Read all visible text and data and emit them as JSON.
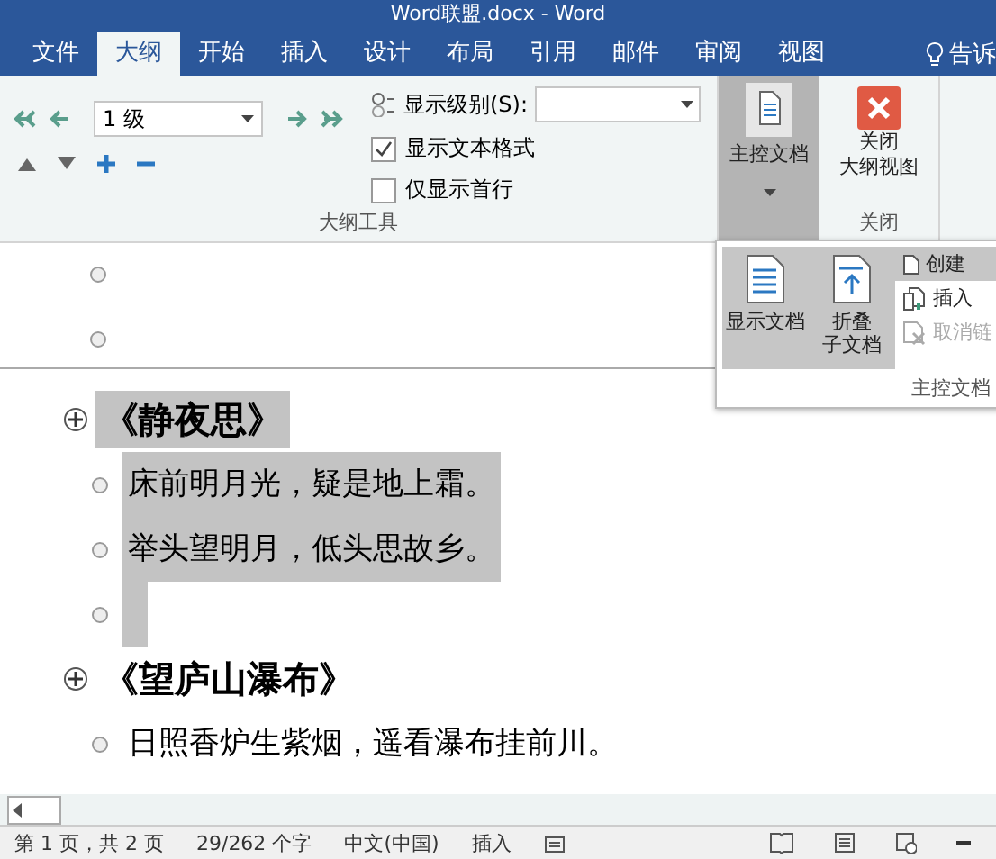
{
  "window": {
    "title": "Word联盟.docx - Word"
  },
  "tabs": [
    {
      "label": "文件",
      "selected": false
    },
    {
      "label": "大纲",
      "selected": true
    },
    {
      "label": "开始",
      "selected": false
    },
    {
      "label": "插入",
      "selected": false
    },
    {
      "label": "设计",
      "selected": false
    },
    {
      "label": "布局",
      "selected": false
    },
    {
      "label": "引用",
      "selected": false
    },
    {
      "label": "邮件",
      "selected": false
    },
    {
      "label": "审阅",
      "selected": false
    },
    {
      "label": "视图",
      "selected": false
    }
  ],
  "tell_me": "告诉",
  "outline_tools": {
    "level_combo": "1 级",
    "show_level_label": "显示级别(S):",
    "checkboxes": [
      {
        "label": "显示文本格式",
        "checked": true
      },
      {
        "label": "仅显示首行",
        "checked": false
      }
    ],
    "group_label": "大纲工具"
  },
  "master_document": {
    "label": "主控文档",
    "pressed": true
  },
  "close_group": {
    "button_lines": [
      "关闭",
      "大纲视图"
    ],
    "group_label": "关闭"
  },
  "master_menu": {
    "big_buttons": [
      {
        "lines": [
          "显示文档"
        ],
        "kind": "show"
      },
      {
        "lines": [
          "折叠",
          "子文档"
        ],
        "kind": "collapse"
      }
    ],
    "small_buttons": [
      {
        "label": "创建",
        "kind": "create",
        "selected": true,
        "disabled": false
      },
      {
        "label": "插入",
        "kind": "insert",
        "selected": false,
        "disabled": false
      },
      {
        "label": "取消链",
        "kind": "unlink",
        "selected": false,
        "disabled": true
      }
    ],
    "group_label": "主控文档"
  },
  "subdocument": {
    "paragraphs": [
      {
        "kind": "empty"
      },
      {
        "kind": "empty"
      }
    ]
  },
  "outline": [
    {
      "text": "《静夜思》",
      "selected": true,
      "children": [
        {
          "text": "床前明月光，疑是地上霜。",
          "selected": true
        },
        {
          "text": "举头望明月，低头思故乡。",
          "selected": true
        },
        {
          "kind": "empty",
          "selected": true
        }
      ]
    },
    {
      "text": "《望庐山瀑布》",
      "selected": false,
      "children": [
        {
          "text": "日照香炉生紫烟，遥看瀑布挂前川。",
          "selected": false
        }
      ]
    }
  ],
  "status_bar": {
    "page": "第 1 页，共 2 页",
    "words": "29/262 个字",
    "language": "中文(中国)",
    "mode": "插入"
  }
}
